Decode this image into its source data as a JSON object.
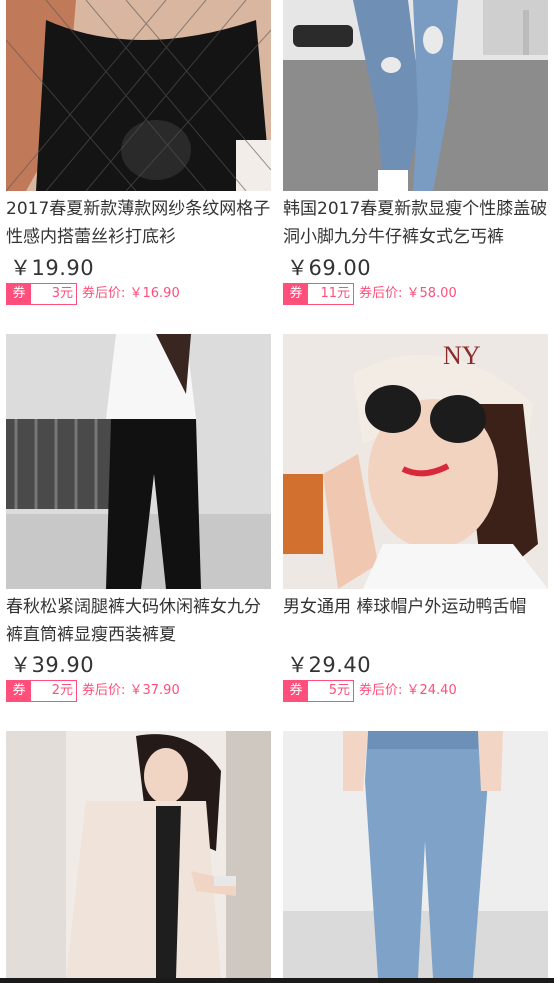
{
  "products": [
    {
      "title": "2017春夏新款薄款网纱条纹网格子性感内搭蕾丝衫打底衫",
      "price": "￥19.90",
      "coupon_tag": "券",
      "coupon_amount": "3元",
      "after_coupon": "券后价: ￥16.90"
    },
    {
      "title": "韩国2017春夏新款显瘦个性膝盖破洞小脚九分牛仔裤女式乞丐裤",
      "price": "￥69.00",
      "coupon_tag": "券",
      "coupon_amount": "11元",
      "after_coupon": "券后价: ￥58.00"
    },
    {
      "title": "春秋松紧阔腿裤大码休闲裤女九分裤直筒裤显瘦西装裤夏",
      "price": "￥39.90",
      "coupon_tag": "券",
      "coupon_amount": "2元",
      "after_coupon": "券后价: ￥37.90"
    },
    {
      "title": "男女通用 棒球帽户外运动鸭舌帽",
      "price": "￥29.40",
      "coupon_tag": "券",
      "coupon_amount": "5元",
      "after_coupon": "券后价: ￥24.40"
    },
    {
      "title": "",
      "price": "",
      "coupon_tag": "",
      "coupon_amount": "",
      "after_coupon": ""
    },
    {
      "title": "",
      "price": "",
      "coupon_tag": "",
      "coupon_amount": "",
      "after_coupon": ""
    }
  ],
  "colors": {
    "accent": "#ff4f7a",
    "text": "#333333"
  }
}
